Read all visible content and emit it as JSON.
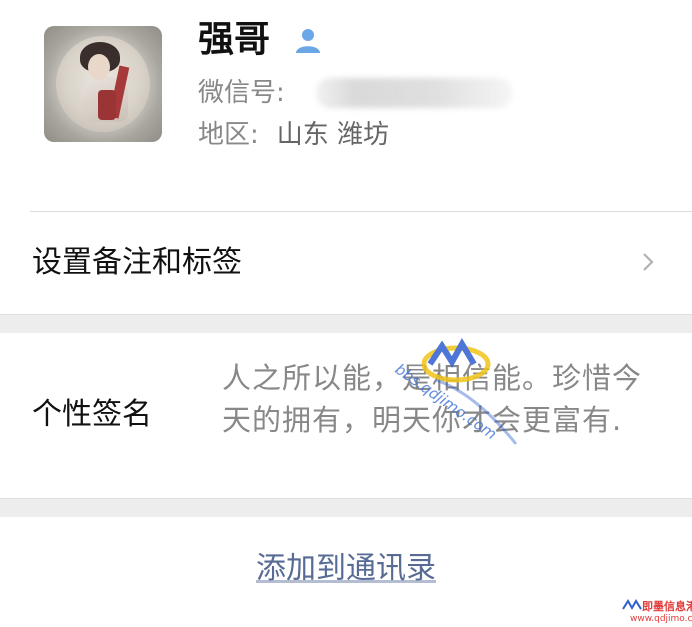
{
  "profile": {
    "name": "强哥",
    "wechat_label": "微信号:",
    "wechat_value_hidden": true,
    "region_label": "地区:",
    "region_value": "山东 潍坊"
  },
  "rows": {
    "remarks_label": "设置备注和标签",
    "signature_label": "个性签名",
    "signature_text": "人之所以能，是相信能。珍惜今天的拥有，明天你才会更富有.",
    "add_contact": "添加到通讯录"
  },
  "watermark": {
    "url": "bbs.qdjimo.com",
    "corner_text": "即墨信息港",
    "corner_url": "www.qdjimo.com"
  },
  "colors": {
    "link": "#576b95",
    "gray_text": "#888888",
    "separator": "#ededed",
    "verified_icon": "#6ba6e6"
  }
}
